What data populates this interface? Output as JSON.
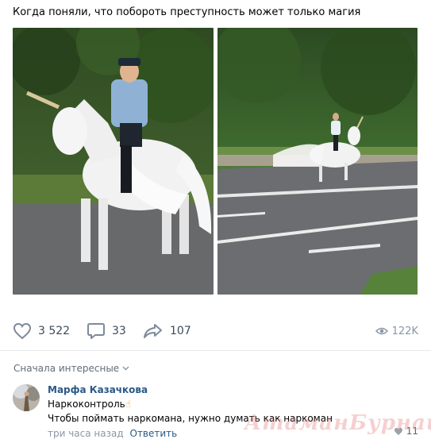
{
  "post": {
    "text": "Когда поняли, что побороть преступность может только магия"
  },
  "photos": [
    {
      "name": "policeman-on-unicorn-closeup"
    },
    {
      "name": "policeman-on-unicorn-road"
    }
  ],
  "actions": {
    "likes": "3 522",
    "comments": "33",
    "shares": "107",
    "views": "122K"
  },
  "comments_section": {
    "sort_label": "Сначала интересные",
    "items": [
      {
        "author": "Марфа Казачкова",
        "line1": "Наркоконтроль",
        "line1_emoji": "☝",
        "line2": "Чтобы поймать наркомана, нужно думать как наркоман",
        "time": "три часа назад",
        "reply": "Ответить",
        "likes": "11"
      }
    ]
  },
  "watermark": "АтаманБурнаш для ЯП",
  "colors": {
    "link": "#2a5885",
    "muted": "#8a96a6",
    "divider": "#e7e8ec",
    "icon": "#7e8a9a"
  }
}
